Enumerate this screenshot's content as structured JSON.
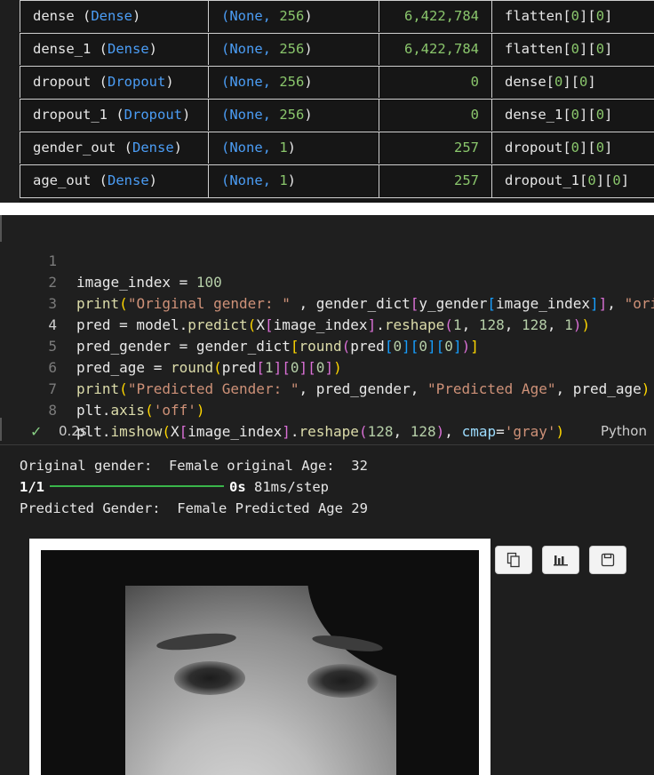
{
  "summary_rows": [
    {
      "name": "dense",
      "type": "Dense",
      "shape_prefix": "(None, ",
      "shape_num": "256",
      "params": "6,422,784",
      "connected": "flatten",
      "idx_a": "0",
      "idx_b": "0"
    },
    {
      "name": "dense_1",
      "type": "Dense",
      "shape_prefix": "(None, ",
      "shape_num": "256",
      "params": "6,422,784",
      "connected": "flatten",
      "idx_a": "0",
      "idx_b": "0"
    },
    {
      "name": "dropout",
      "type": "Dropout",
      "shape_prefix": "(None, ",
      "shape_num": "256",
      "params": "0",
      "connected": "dense",
      "idx_a": "0",
      "idx_b": "0"
    },
    {
      "name": "dropout_1",
      "type": "Dropout",
      "shape_prefix": "(None, ",
      "shape_num": "256",
      "params": "0",
      "connected": "dense_1",
      "idx_a": "0",
      "idx_b": "0"
    },
    {
      "name": "gender_out",
      "type": "Dense",
      "shape_prefix": "(None, ",
      "shape_num": "1",
      "params": "257",
      "connected": "dropout",
      "idx_a": "0",
      "idx_b": "0"
    },
    {
      "name": "age_out",
      "type": "Dense",
      "shape_prefix": "(None, ",
      "shape_num": "1",
      "params": "257",
      "connected": "dropout_1",
      "idx_a": "0",
      "idx_b": "0"
    }
  ],
  "code_lines": [
    {
      "n": "1",
      "text": "image_index = 100"
    },
    {
      "n": "2",
      "text": "print(\"Original gender: \" , gender_dict[y_gender[image_index]], \"ori"
    },
    {
      "n": "3",
      "text": "pred = model.predict(X[image_index].reshape(1, 128, 128, 1))"
    },
    {
      "n": "4",
      "text": "pred_gender = gender_dict[round(pred[0][0][0])]"
    },
    {
      "n": "5",
      "text": "pred_age = round(pred[1][0][0])"
    },
    {
      "n": "6",
      "text": "print(\"Predicted Gender: \", pred_gender, \"Predicted Age\", pred_age)"
    },
    {
      "n": "7",
      "text": "plt.axis('off')"
    },
    {
      "n": "8",
      "text": "plt.imshow(X[image_index].reshape(128, 128), cmap='gray')"
    }
  ],
  "cell_status": {
    "check": "✓",
    "time": "0.2s",
    "language": "Python"
  },
  "output": {
    "line1": "Original gender:  Female original Age:  32",
    "progress_label": "1/1",
    "progress_time": "0s",
    "progress_rate": " 81ms/step",
    "progress_value": 1.0,
    "line3": "Predicted Gender:  Female Predicted Age 29"
  },
  "toolbar_icons": [
    "copy-icon",
    "chart-icon",
    "save-icon"
  ],
  "colors": {
    "accent_blue": "#4b9df5",
    "number_green": "#8ac66c",
    "progress_green": "#39b54a"
  }
}
